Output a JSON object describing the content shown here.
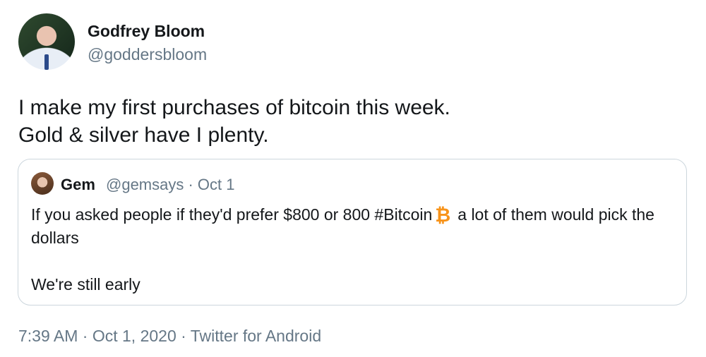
{
  "tweet": {
    "author_name": "Godfrey Bloom",
    "author_handle": "@goddersbloom",
    "text": "I make my first purchases of bitcoin this week.\nGold & silver have I plenty.",
    "timestamp": "7:39 AM · Oct 1, 2020 · Twitter for Android"
  },
  "quoted": {
    "name": "Gem",
    "meta": "@gemsays · Oct 1",
    "text_before_emoji": "If you asked people if they'd prefer $800 or 800 #Bitcoin",
    "emoji_glyph": "₿",
    "text_after_emoji": "a lot of them would pick the dollars",
    "text_last": "We're still early"
  },
  "icons": {
    "emoji": "bitcoin-icon"
  }
}
